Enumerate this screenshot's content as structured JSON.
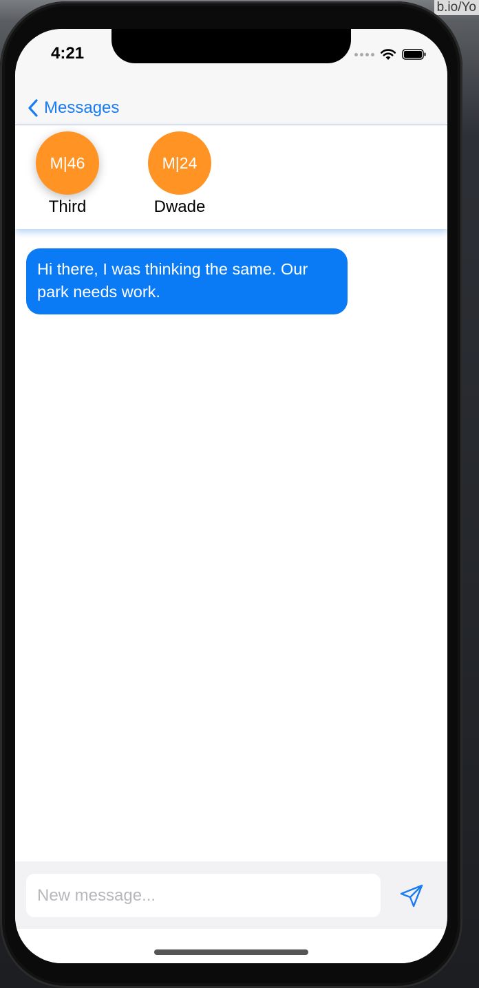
{
  "browser": {
    "url_fragment": "b.io/Yo"
  },
  "status_bar": {
    "time": "4:21"
  },
  "nav": {
    "back_label": "Messages"
  },
  "contacts": [
    {
      "initials": "M|46",
      "name": "Third"
    },
    {
      "initials": "M|24",
      "name": "Dwade"
    }
  ],
  "messages": [
    {
      "text": "Hi there, I was thinking the same. Our park needs work."
    }
  ],
  "composer": {
    "placeholder": "New message...",
    "value": ""
  },
  "colors": {
    "accent": "#1a7cf0",
    "bubble": "#0a7bf5",
    "avatar": "#ff9424"
  },
  "icons": {
    "back": "chevron-left-icon",
    "send": "paper-plane-icon",
    "wifi": "wifi-icon",
    "battery": "battery-icon"
  }
}
